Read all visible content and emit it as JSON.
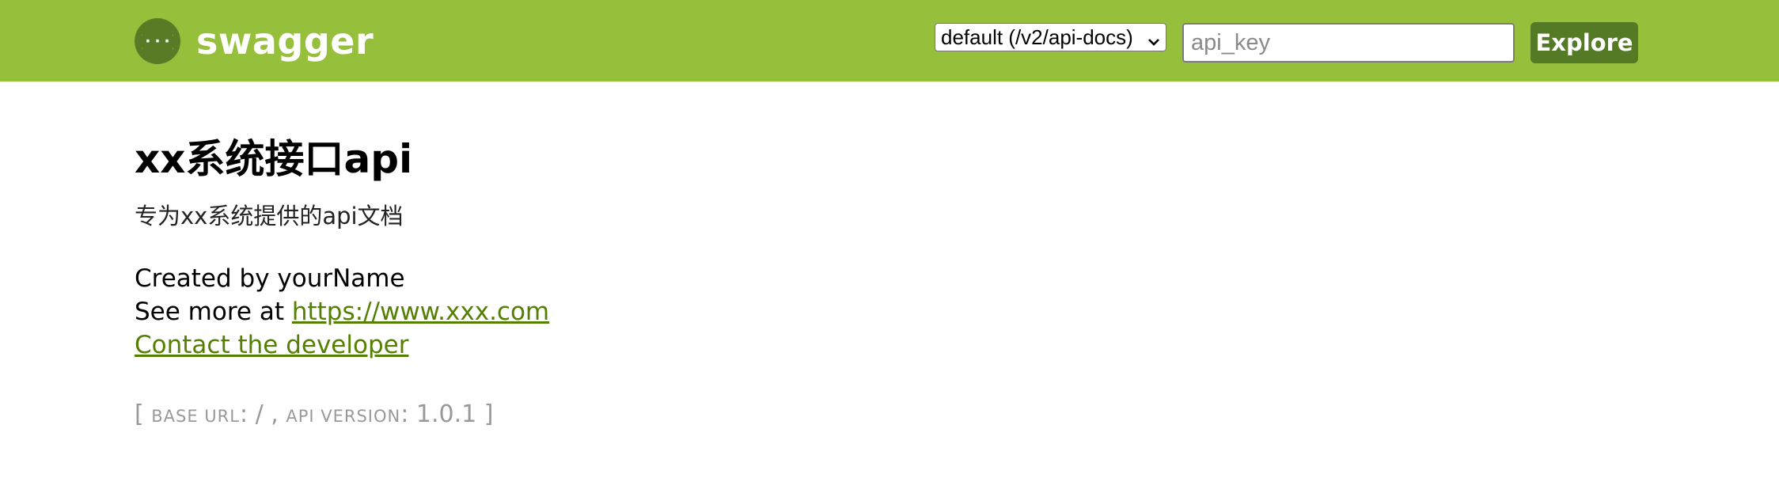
{
  "header": {
    "brand": "swagger",
    "spec_select_value": "default (/v2/api-docs)",
    "api_key_placeholder": "api_key",
    "explore_label": "Explore",
    "colors": {
      "header_bg": "#96bf3c",
      "button_bg": "#557a26",
      "link": "#547f00"
    }
  },
  "info": {
    "title": "xx系统接口api",
    "description": "专为xx系统提供的api文档",
    "created_by": "Created by yourName",
    "see_more_prefix": "See more at ",
    "see_more_link": "https://www.xxx.com",
    "contact_link": "Contact the developer"
  },
  "footer": {
    "open_bracket": "[ ",
    "base_url_label": "base url",
    "base_url_value": ": / , ",
    "api_version_label": "api version",
    "api_version_value": ": 1.0.1 ]"
  }
}
